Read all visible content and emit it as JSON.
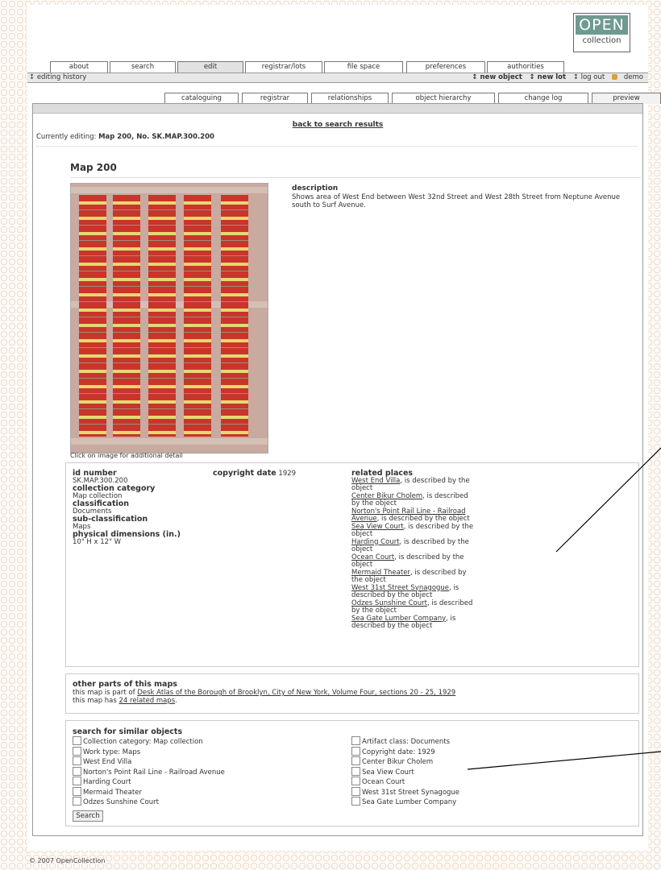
{
  "logo": {
    "top": "OPEN",
    "bottom": "collection"
  },
  "main_tabs": [
    "about",
    "search",
    "edit",
    "registrar/lots",
    "file space",
    "preferences",
    "authorities"
  ],
  "subbar": {
    "history": "↕ editing history",
    "new_object": "↕ new object",
    "new_lot": "↕ new lot",
    "log_out": "↕ log out",
    "user": "demo"
  },
  "sub_tabs": [
    "cataloguing",
    "registrar",
    "relationships",
    "object hierarchy",
    "change log",
    "preview"
  ],
  "back_link": "back to search results",
  "editing": {
    "prefix": "Currently editing:",
    "value": "Map 200, No. SK.MAP.300.200"
  },
  "object": {
    "title": "Map 200",
    "image_caption": "Click on image for additional detail",
    "description_label": "description",
    "description": "Shows area of West End between West 32nd Street and West 28th Street from Neptune Avenue south to Surf Avenue."
  },
  "meta": {
    "id_label": "id number",
    "id": "SK.MAP.300.200",
    "category_label": "collection category",
    "category": "Map collection",
    "classification_label": "classification",
    "classification": "Documents",
    "subclass_label": "sub-classification",
    "subclass": "Maps",
    "dims_label": "physical dimensions (in.)",
    "dims": "10\" H x 12\" W",
    "copyright_label": "copyright date",
    "copyright": "1929",
    "places_label": "related places",
    "places": [
      {
        "name": "West End Villa",
        "suffix": ", is described by the object"
      },
      {
        "name": "Center Bikur Cholem",
        "suffix": ", is described by the object"
      },
      {
        "name": "Norton's Point Rail Line - Railroad Avenue",
        "suffix": ", is described by the object"
      },
      {
        "name": "Sea View Court",
        "suffix": ", is described by the object"
      },
      {
        "name": "Harding Court",
        "suffix": ", is described by the object"
      },
      {
        "name": "Ocean Court",
        "suffix": ", is described by the object"
      },
      {
        "name": "Mermaid Theater",
        "suffix": ", is described by the object"
      },
      {
        "name": "West 31st Street Synagogue",
        "suffix": ", is described by the object"
      },
      {
        "name": "Odzes Sunshine Court",
        "suffix": ", is described by the object"
      },
      {
        "name": "Sea Gate Lumber Company",
        "suffix": ", is described by the object"
      }
    ]
  },
  "other_parts": {
    "title": "other parts of this maps",
    "line1_prefix": "this map is part of ",
    "line1_link": "Desk Atlas of the Borough of Brooklyn, City of New York, Volume Four, sections 20 - 25, 1929",
    "line2_prefix": "this map has ",
    "line2_link": "24 related maps",
    "line2_suffix": "."
  },
  "similar": {
    "title": "search for similar objects",
    "left": [
      "Collection category: Map collection",
      "Work type: Maps",
      "West End Villa",
      "Norton's Point Rail Line - Railroad Avenue",
      "Harding Court",
      "Mermaid Theater",
      "Odzes Sunshine Court"
    ],
    "right": [
      "Artifact class: Documents",
      "Copyright date: 1929",
      "Center Bikur Cholem",
      "Sea View Court",
      "Ocean Court",
      "West 31st Street Synagogue",
      "Sea Gate Lumber Company"
    ],
    "button": "Search"
  },
  "footer": "© 2007 OpenCollection",
  "colors": {
    "tab_active": "#e2e2e2",
    "map_red": "#c9352a",
    "map_yellow": "#e6d872",
    "logo_teal": "#6f9a90"
  }
}
